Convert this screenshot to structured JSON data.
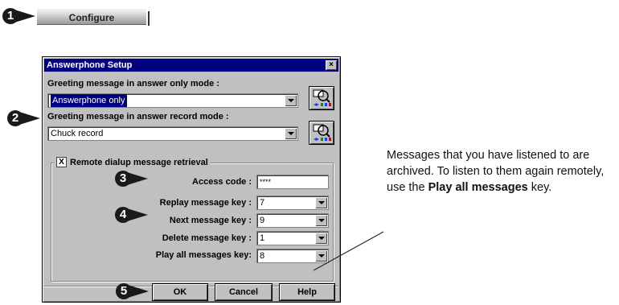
{
  "configure": {
    "label": "Configure"
  },
  "steps": [
    "1",
    "2",
    "3",
    "4",
    "5"
  ],
  "dialog": {
    "title": "Answerphone Setup",
    "close": "×",
    "answer_only_label": "Greeting message in answer only mode :",
    "answer_only_value": "Answerphone only",
    "answer_record_label": "Greeting message in answer record mode :",
    "answer_record_value": "Chuck record",
    "remote": {
      "checkbox_label": "Remote dialup message retrieval",
      "checked_mark": "X",
      "access_code_label": "Access code :",
      "access_code_value": "****",
      "replay_label": "Replay message key :",
      "replay_value": "7",
      "next_label": "Next message key :",
      "next_value": "9",
      "delete_label": "Delete message key :",
      "delete_value": "1",
      "playall_label": "Play all messages key:",
      "playall_value": "8"
    },
    "buttons": {
      "ok": "OK",
      "cancel": "Cancel",
      "help": "Help"
    }
  },
  "note": {
    "text1": "Messages that you have listened to are archived. To listen to them again remotely, use the ",
    "bold": "Play all messages",
    "text2": " key."
  },
  "colors": {
    "titlebar": "#000080",
    "dialog_bg": "#c0c0c0",
    "marker": "#1a1a1a"
  }
}
